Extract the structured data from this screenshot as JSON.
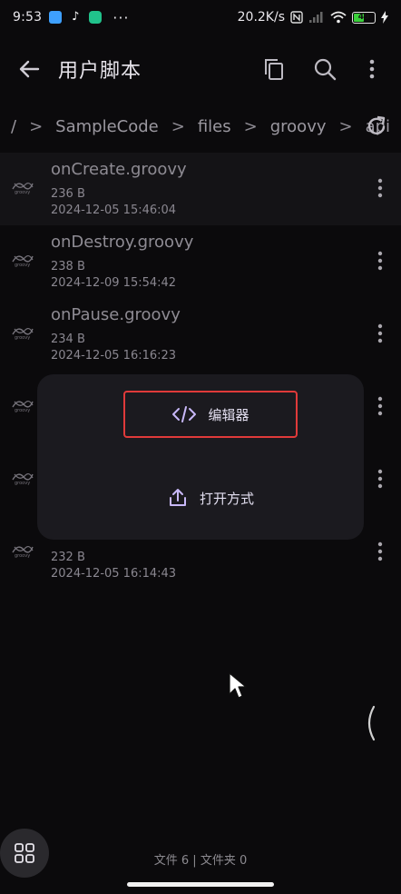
{
  "status_bar": {
    "time": "9:53",
    "net_speed": "20.2K/s",
    "battery": "49",
    "more": "···"
  },
  "app_bar": {
    "title": "用户脚本"
  },
  "breadcrumb": {
    "root": "/",
    "separator": ">",
    "segments": [
      "SampleCode",
      "files",
      "groovy",
      "api"
    ]
  },
  "files": [
    {
      "name": "onCreate.groovy",
      "size": "236 B",
      "date": "2024-12-05 15:46:04"
    },
    {
      "name": "onDestroy.groovy",
      "size": "238 B",
      "date": "2024-12-09 15:54:42"
    },
    {
      "name": "onPause.groovy",
      "size": "234 B",
      "date": "2024-12-05 16:16:23"
    },
    {
      "name": "",
      "size": "",
      "date": ""
    },
    {
      "name": "",
      "size": "",
      "date": ""
    },
    {
      "name": "",
      "size": "232 B",
      "date": "2024-12-05 16:14:43"
    }
  ],
  "dialog": {
    "editor_label": "编辑器",
    "open_with_label": "打开方式"
  },
  "footer": {
    "stats": "文件 6 | 文件夹 0"
  },
  "colors": {
    "background": "#0b0a0c",
    "dialog": "#1b1a1f",
    "highlight_border": "#e03a3a",
    "accent_icon": "#c8b8f8"
  }
}
